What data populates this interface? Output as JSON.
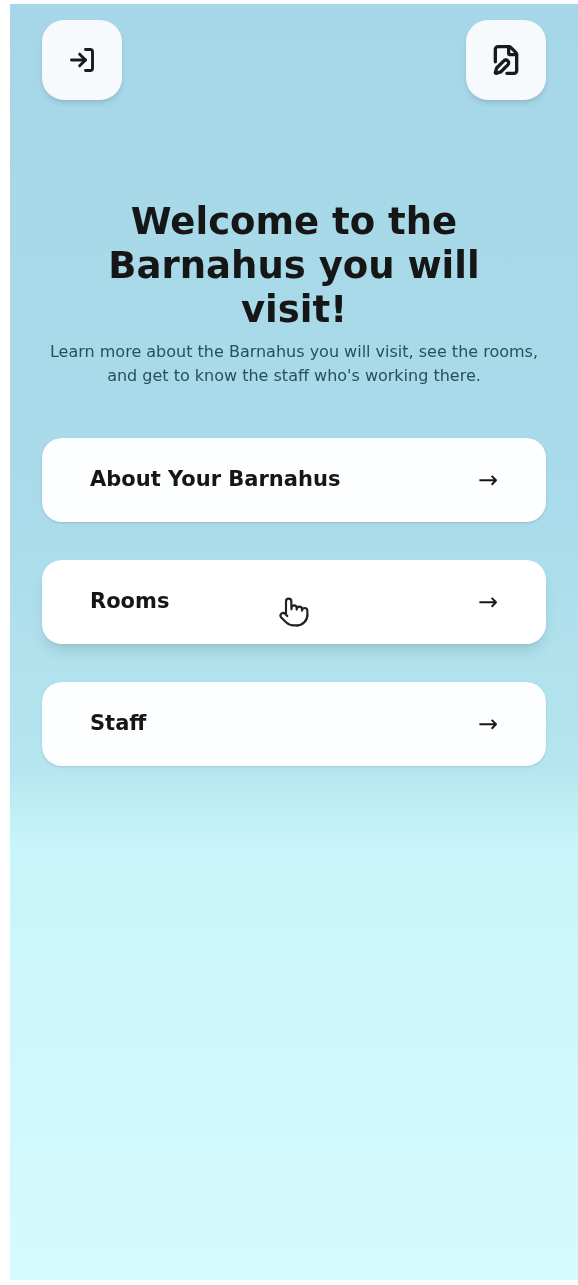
{
  "header": {
    "left_button": {
      "kind": "sign-in"
    },
    "right_button": {
      "kind": "edit-document"
    }
  },
  "title": "Welcome to the Barnahus you will visit!",
  "subtitle": "Learn more about the Barnahus you will visit, see the rooms, and get to know the staff who's working there.",
  "menu": [
    {
      "label": "About Your Barnahus",
      "arrow": "→",
      "hovered": false
    },
    {
      "label": "Rooms",
      "arrow": "→",
      "hovered": true
    },
    {
      "label": "Staff",
      "arrow": "→",
      "hovered": false
    }
  ]
}
